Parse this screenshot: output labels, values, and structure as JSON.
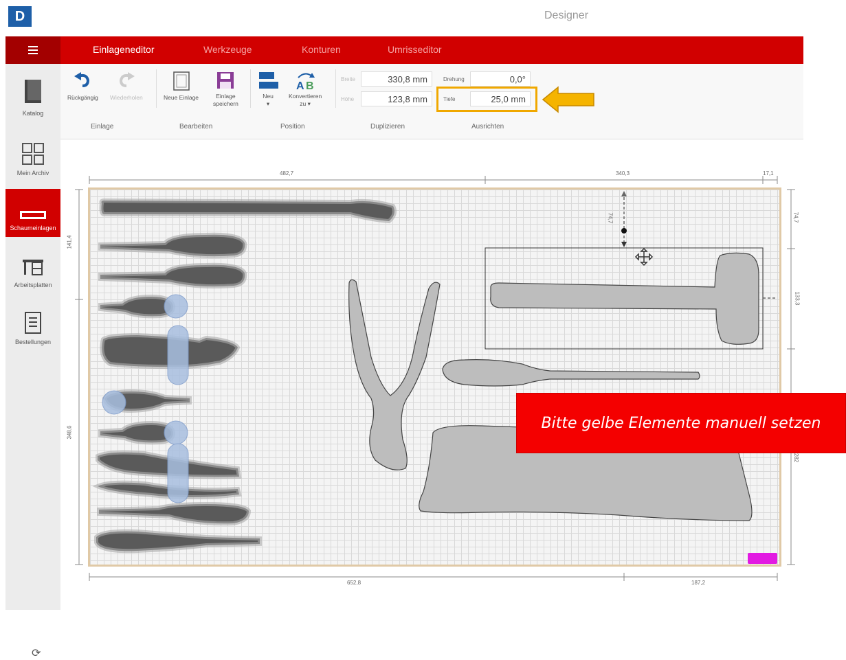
{
  "app": {
    "logo_letter": "D",
    "title": "Designer"
  },
  "tabs": [
    {
      "label": "Einlageneditor",
      "active": true
    },
    {
      "label": "Werkzeuge",
      "active": false
    },
    {
      "label": "Konturen",
      "active": false
    },
    {
      "label": "Umrisseditor",
      "active": false
    }
  ],
  "sidebar": {
    "items": [
      {
        "label": "Katalog",
        "icon": "catalog-icon"
      },
      {
        "label": "Mein Archiv",
        "icon": "grid-icon"
      },
      {
        "label": "Schaumeinlagen",
        "icon": "foam-insert-icon",
        "active": true
      },
      {
        "label": "Arbeitsplatten",
        "icon": "workbench-icon"
      },
      {
        "label": "Bestellungen",
        "icon": "orders-icon"
      }
    ]
  },
  "toolbar": {
    "undo_label": "Rückgängig",
    "redo_label": "Wiederholen",
    "new_insert_label": "Neue Einlage",
    "save_insert_label_1": "Einlage",
    "save_insert_label_2": "speichern",
    "new_label": "Neu",
    "convert_label_1": "Konvertieren",
    "convert_label_2": "zu ▾",
    "groups": [
      "Einlage",
      "Bearbeiten",
      "Position",
      "Duplizieren",
      "Ausrichten"
    ]
  },
  "fields": {
    "width_label": "Breite",
    "width_value": "330,8 mm",
    "height_label": "Höhe",
    "height_value": "123,8 mm",
    "rotation_label": "Drehung",
    "rotation_value": "0,0°",
    "depth_label": "Tiefe",
    "depth_value": "25,0 mm"
  },
  "dimensions": {
    "top_left": "482,7",
    "top_mid": "340,3",
    "top_right": "17,1",
    "left_top": "141,4",
    "left_bottom": "348,6",
    "right_top": "74,7",
    "right_mid": "133,3",
    "right_bottom": "282",
    "bottom_left": "652,8",
    "bottom_right": "187,2",
    "vertical_offset": "74,7"
  },
  "note": "Bitte gelbe Elemente manuell setzen",
  "colors": {
    "brand_red": "#d10000",
    "highlight": "#f0a800",
    "note_bg": "#f40000",
    "marker": "#e21ae2"
  }
}
